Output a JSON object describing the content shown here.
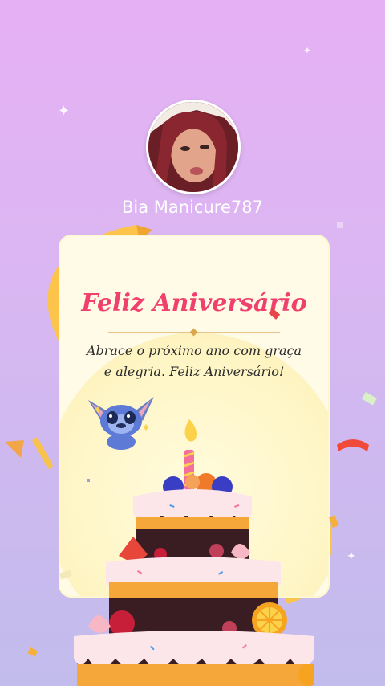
{
  "profile": {
    "username": "Bia Manicure787"
  },
  "card": {
    "title": "Feliz Aniversário",
    "message": "Abrace o próximo ano com graça e alegria. Feliz Aniversário!"
  },
  "colors": {
    "background_top": "#e6b0f4",
    "background_bottom": "#c2bcec",
    "title": "#f0406e",
    "card": "#fffbe6"
  },
  "icons": [
    "sparkle-icon",
    "avatar",
    "stitch-sticker",
    "birthday-cake",
    "candle",
    "confetti"
  ]
}
